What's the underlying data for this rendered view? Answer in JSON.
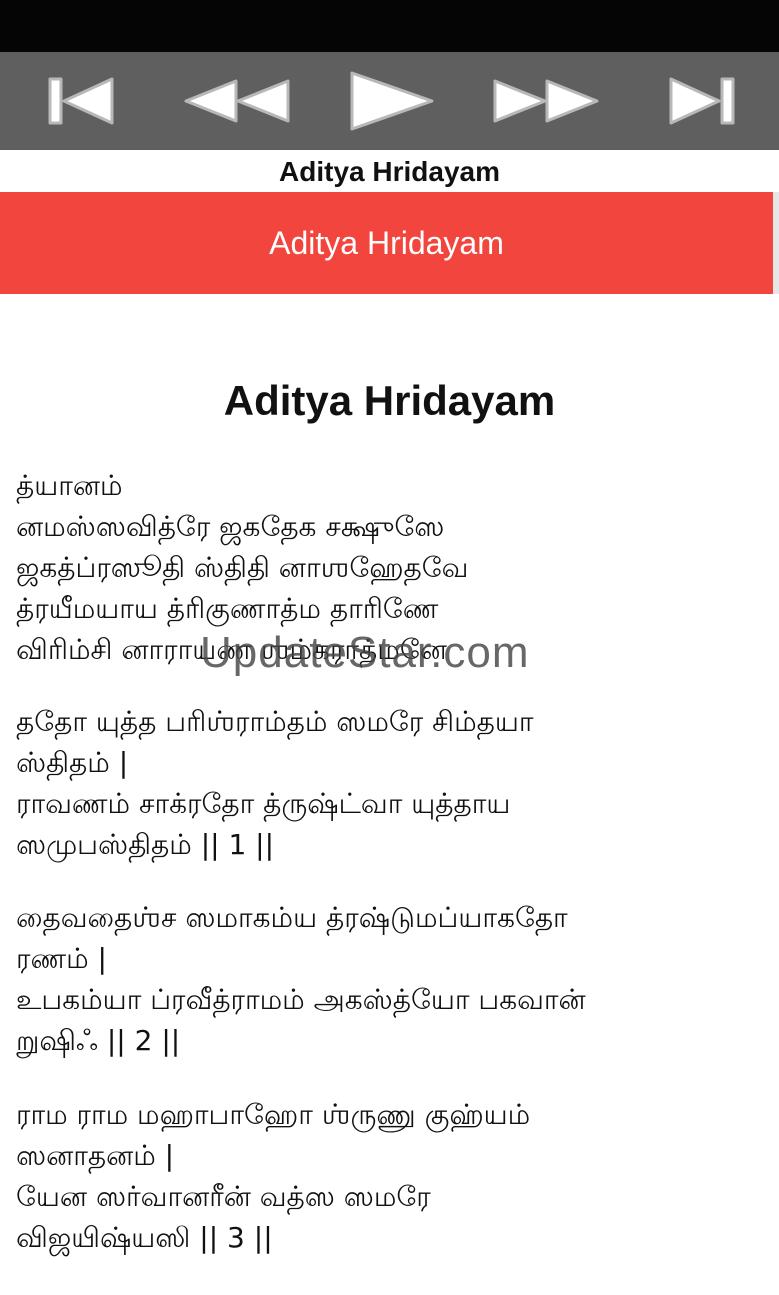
{
  "colors": {
    "player_bg": "#5f5f5f",
    "banner_bg": "#f2453d",
    "status_bar_bg": "#050505"
  },
  "player": {
    "buttons": [
      {
        "icon": "skip-previous-icon"
      },
      {
        "icon": "rewind-icon"
      },
      {
        "icon": "play-icon"
      },
      {
        "icon": "fast-forward-icon"
      },
      {
        "icon": "skip-next-icon"
      }
    ]
  },
  "app_title": "Aditya Hridayam",
  "banner_title": "Aditya Hridayam",
  "document": {
    "heading": "Aditya Hridayam",
    "verses": [
      {
        "lines": [
          "த்யானம்",
          "னமஸ்ஸவித்ரே ஜகதேக சக்ஷுஸே",
          "ஜகத்ப்ரஸூதி ஸ்திதி னாஶஹேதவே",
          "த்ரயீமயாய த்ரிகுணாத்ம தாரிணே",
          "விரிம்சி னாராயண ஶம்கராத்மனே"
        ]
      },
      {
        "lines": [
          "ததோ யுத்த பரிஶ்ராம்தம் ஸமரே சிம்தயா",
          "ஸ்திதம் |",
          "ராவணம் சாக்ரதோ த்ருஷ்ட்வா யுத்தாய",
          "ஸமுபஸ்திதம் || 1 ||"
        ]
      },
      {
        "lines": [
          "தைவதைஶ்ச ஸமாகம்ய த்ரஷ்டுமப்யாகதோ",
          "ரணம் |",
          "உபகம்யா ப்ரவீத்ராமம் அகஸ்த்யோ பகவான்",
          "றுஷிஃ || 2 ||"
        ]
      },
      {
        "lines": [
          "ராம ராம மஹாபாஹோ ஶ்ருணு குஹ்யம்",
          "ஸனாதனம் |",
          "யேன ஸர்வானரீன் வத்ஸ ஸமரே",
          "விஜயிஷ்யஸி || 3 ||"
        ]
      }
    ]
  },
  "watermark": "UpdateStar.com"
}
